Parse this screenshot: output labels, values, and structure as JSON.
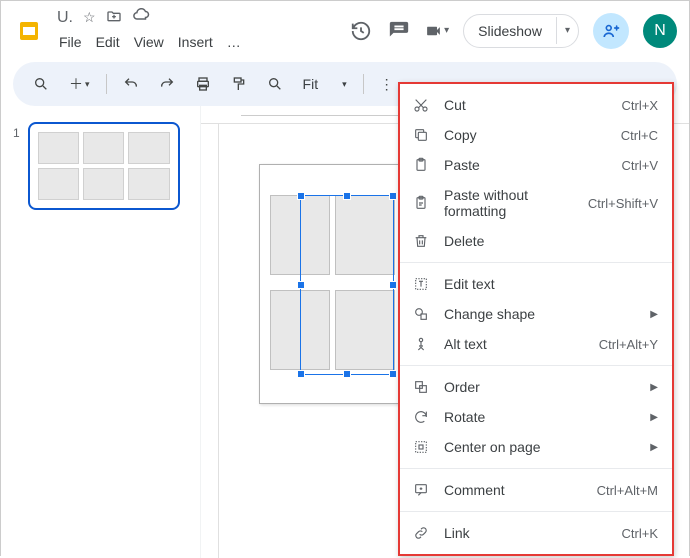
{
  "doc_title": "U.",
  "menu": {
    "items": [
      "File",
      "Edit",
      "View",
      "Insert",
      "…"
    ]
  },
  "header": {
    "slideshow_label": "Slideshow",
    "avatar_letter": "N"
  },
  "toolbar": {
    "fit_label": "Fit"
  },
  "filmstrip": {
    "slide_number": "1"
  },
  "context_menu": {
    "items": [
      {
        "icon": "cut",
        "label": "Cut",
        "shortcut": "Ctrl+X",
        "submenu": false
      },
      {
        "icon": "copy",
        "label": "Copy",
        "shortcut": "Ctrl+C",
        "submenu": false
      },
      {
        "icon": "paste",
        "label": "Paste",
        "shortcut": "Ctrl+V",
        "submenu": false
      },
      {
        "icon": "paste-no-format",
        "label": "Paste without formatting",
        "shortcut": "Ctrl+Shift+V",
        "submenu": false
      },
      {
        "icon": "delete",
        "label": "Delete",
        "shortcut": "",
        "submenu": false
      },
      {
        "sep": true
      },
      {
        "icon": "edit-text",
        "label": "Edit text",
        "shortcut": "",
        "submenu": false
      },
      {
        "icon": "change-shape",
        "label": "Change shape",
        "shortcut": "",
        "submenu": true
      },
      {
        "icon": "alt-text",
        "label": "Alt text",
        "shortcut": "Ctrl+Alt+Y",
        "submenu": false
      },
      {
        "sep": true
      },
      {
        "icon": "order",
        "label": "Order",
        "shortcut": "",
        "submenu": true
      },
      {
        "icon": "rotate",
        "label": "Rotate",
        "shortcut": "",
        "submenu": true
      },
      {
        "icon": "center",
        "label": "Center on page",
        "shortcut": "",
        "submenu": true
      },
      {
        "sep": true
      },
      {
        "icon": "comment",
        "label": "Comment",
        "shortcut": "Ctrl+Alt+M",
        "submenu": false
      },
      {
        "sep": true
      },
      {
        "icon": "link",
        "label": "Link",
        "shortcut": "Ctrl+K",
        "submenu": false
      }
    ]
  }
}
